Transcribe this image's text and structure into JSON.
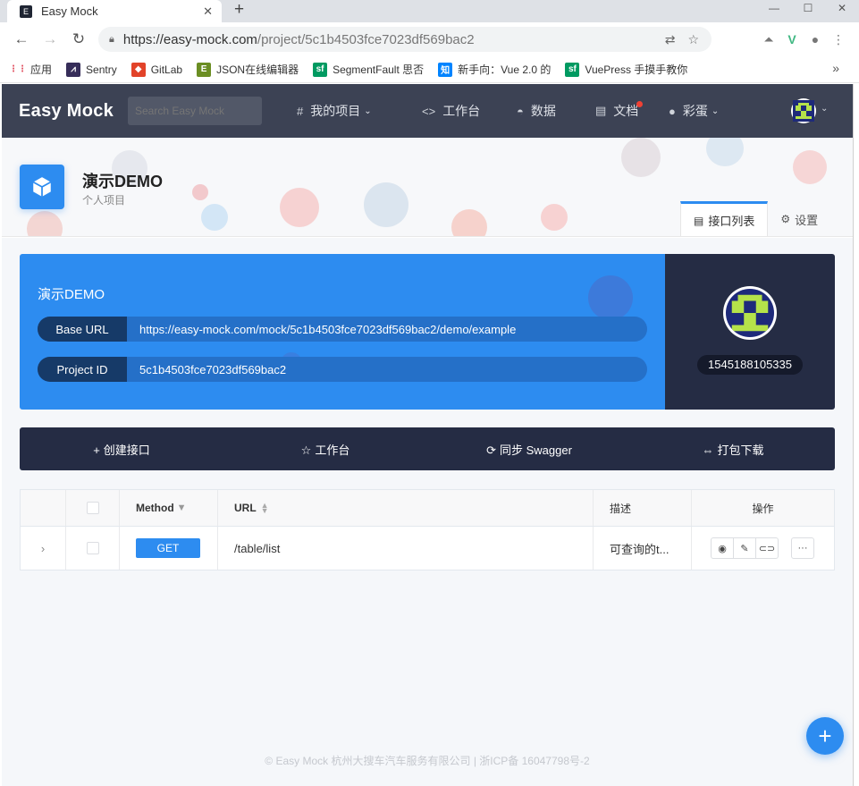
{
  "browser": {
    "tab_title": "Easy Mock",
    "tab_close": "✕",
    "new_tab": "+",
    "url_host": "https://easy-mock.com",
    "url_path": "/project/5c1b4503fce7023df569bac2",
    "bookmarks": [
      {
        "label": "应用",
        "color": "#ffffff"
      },
      {
        "label": "Sentry",
        "color": "#362d59"
      },
      {
        "label": "GitLab",
        "color": "#e24329"
      },
      {
        "label": "JSON在线编辑器",
        "color": "#6b8e23"
      },
      {
        "label": "SegmentFault 思否",
        "color": "#009a61"
      },
      {
        "label": "新手向：Vue 2.0 的",
        "color": "#0084ff"
      },
      {
        "label": "VuePress 手摸手教你",
        "color": "#009a61"
      }
    ],
    "bookmark_icons": [
      "⋮⋮",
      "⩘",
      "◆",
      "E",
      "sf",
      "知",
      "sf"
    ]
  },
  "app": {
    "logo": "Easy Mock",
    "search_placeholder": "Search Easy Mock",
    "nav": [
      {
        "icon": "#",
        "label": "我的项目",
        "caret": true
      },
      {
        "icon": "<>",
        "label": "工作台",
        "caret": false
      },
      {
        "icon": "◓",
        "label": "数据",
        "caret": false
      },
      {
        "icon": "▤",
        "label": "文档",
        "caret": false
      },
      {
        "icon": "●",
        "label": "彩蛋",
        "caret": true
      }
    ],
    "accent": "#2d8cf0",
    "header_bg": "#3c4254"
  },
  "project": {
    "name": "演示DEMO",
    "subtitle": "个人项目",
    "tabs": [
      {
        "label": "接口列表",
        "icon": "▤",
        "active": true
      },
      {
        "label": "设置",
        "icon": "⚙",
        "active": false
      }
    ]
  },
  "info": {
    "title": "演示DEMO",
    "base_url_label": "Base URL",
    "base_url": "https://easy-mock.com/mock/5c1b4503fce7023df569bac2/demo/example",
    "project_id_label": "Project ID",
    "project_id": "5c1b4503fce7023df569bac2",
    "user_id": "1545188105335"
  },
  "actions": [
    {
      "icon": "+",
      "label": "创建接口"
    },
    {
      "icon": "☆",
      "label": "工作台"
    },
    {
      "icon": "⟳",
      "label": "同步 Swagger"
    },
    {
      "icon": "⇔",
      "label": "打包下载"
    }
  ],
  "table": {
    "headers": {
      "method": "Method",
      "url": "URL",
      "desc": "描述",
      "ops": "操作"
    },
    "rows": [
      {
        "expand": "›",
        "method": "GET",
        "url": "/table/list",
        "desc": "可查询的t..."
      }
    ],
    "op_icons": [
      "eye-icon",
      "pencil-icon",
      "link-icon",
      "more-icon"
    ]
  },
  "footer": "© Easy Mock 杭州大搜车汽车服务有限公司 | 浙ICP备 16047798号-2",
  "fab": "+"
}
